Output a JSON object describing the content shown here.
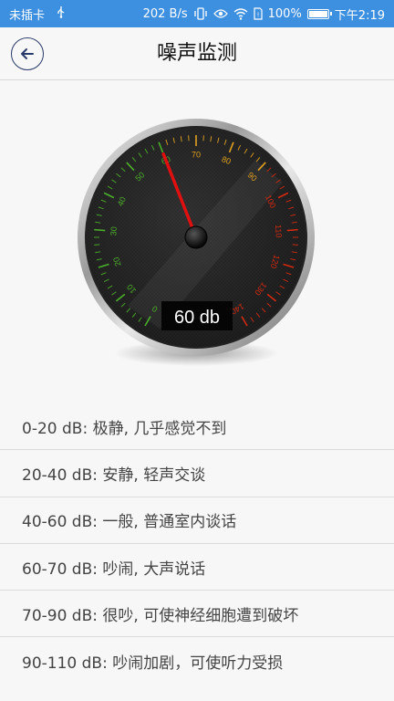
{
  "status_bar": {
    "carrier": "未插卡",
    "usb_icon": "usb-icon",
    "speed": "202 B/s",
    "battery": "100%",
    "time": "下午2:19"
  },
  "header": {
    "title": "噪声监测",
    "back_icon": "arrow-left-icon"
  },
  "gauge": {
    "value": 60,
    "readout": "60 db",
    "min": 0,
    "max": 140,
    "tick_labels": [
      "0",
      "10",
      "20",
      "30",
      "40",
      "50",
      "60",
      "70",
      "80",
      "90",
      "100",
      "110",
      "120",
      "130",
      "140"
    ]
  },
  "levels": [
    "0-20 dB: 极静, 几乎感觉不到",
    "20-40 dB: 安静, 轻声交谈",
    "40-60 dB: 一般, 普通室内谈话",
    "60-70 dB: 吵闹, 大声说话",
    "70-90 dB: 很吵, 可使神经细胞遭到破坏",
    "90-110 dB: 吵闹加剧，可使听力受损"
  ]
}
